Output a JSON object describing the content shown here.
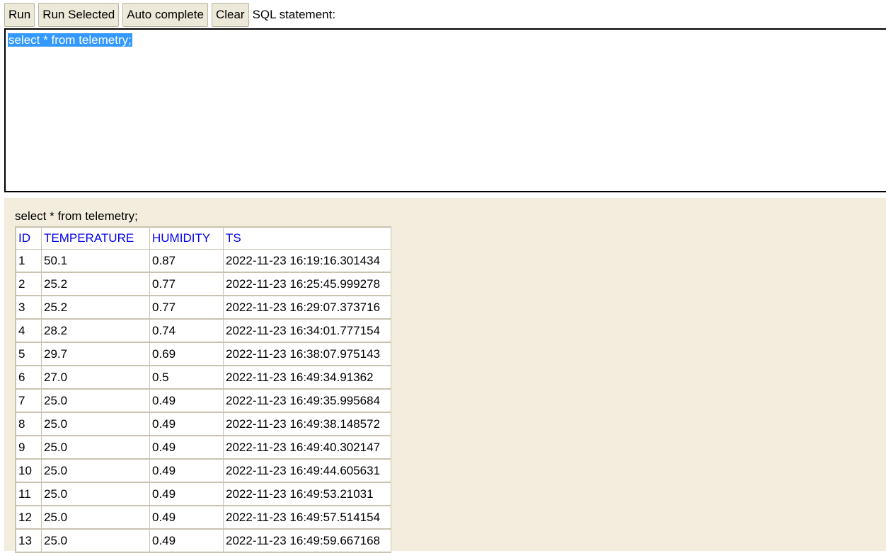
{
  "toolbar": {
    "run_label": "Run",
    "run_selected_label": "Run Selected",
    "auto_complete_label": "Auto complete",
    "clear_label": "Clear",
    "sql_statement_label": "SQL statement:"
  },
  "editor": {
    "text": "select * from telemetry;"
  },
  "results": {
    "query": "select * from telemetry;",
    "columns": [
      "ID",
      "TEMPERATURE",
      "HUMIDITY",
      "TS"
    ],
    "rows": [
      [
        "1",
        "50.1",
        "0.87",
        "2022-11-23 16:19:16.301434"
      ],
      [
        "2",
        "25.2",
        "0.77",
        "2022-11-23 16:25:45.999278"
      ],
      [
        "3",
        "25.2",
        "0.77",
        "2022-11-23 16:29:07.373716"
      ],
      [
        "4",
        "28.2",
        "0.74",
        "2022-11-23 16:34:01.777154"
      ],
      [
        "5",
        "29.7",
        "0.69",
        "2022-11-23 16:38:07.975143"
      ],
      [
        "6",
        "27.0",
        "0.5",
        "2022-11-23 16:49:34.91362"
      ],
      [
        "7",
        "25.0",
        "0.49",
        "2022-11-23 16:49:35.995684"
      ],
      [
        "8",
        "25.0",
        "0.49",
        "2022-11-23 16:49:38.148572"
      ],
      [
        "9",
        "25.0",
        "0.49",
        "2022-11-23 16:49:40.302147"
      ],
      [
        "10",
        "25.0",
        "0.49",
        "2022-11-23 16:49:44.605631"
      ],
      [
        "11",
        "25.0",
        "0.49",
        "2022-11-23 16:49:53.21031"
      ],
      [
        "12",
        "25.0",
        "0.49",
        "2022-11-23 16:49:57.514154"
      ],
      [
        "13",
        "25.0",
        "0.49",
        "2022-11-23 16:49:59.667168"
      ]
    ]
  }
}
